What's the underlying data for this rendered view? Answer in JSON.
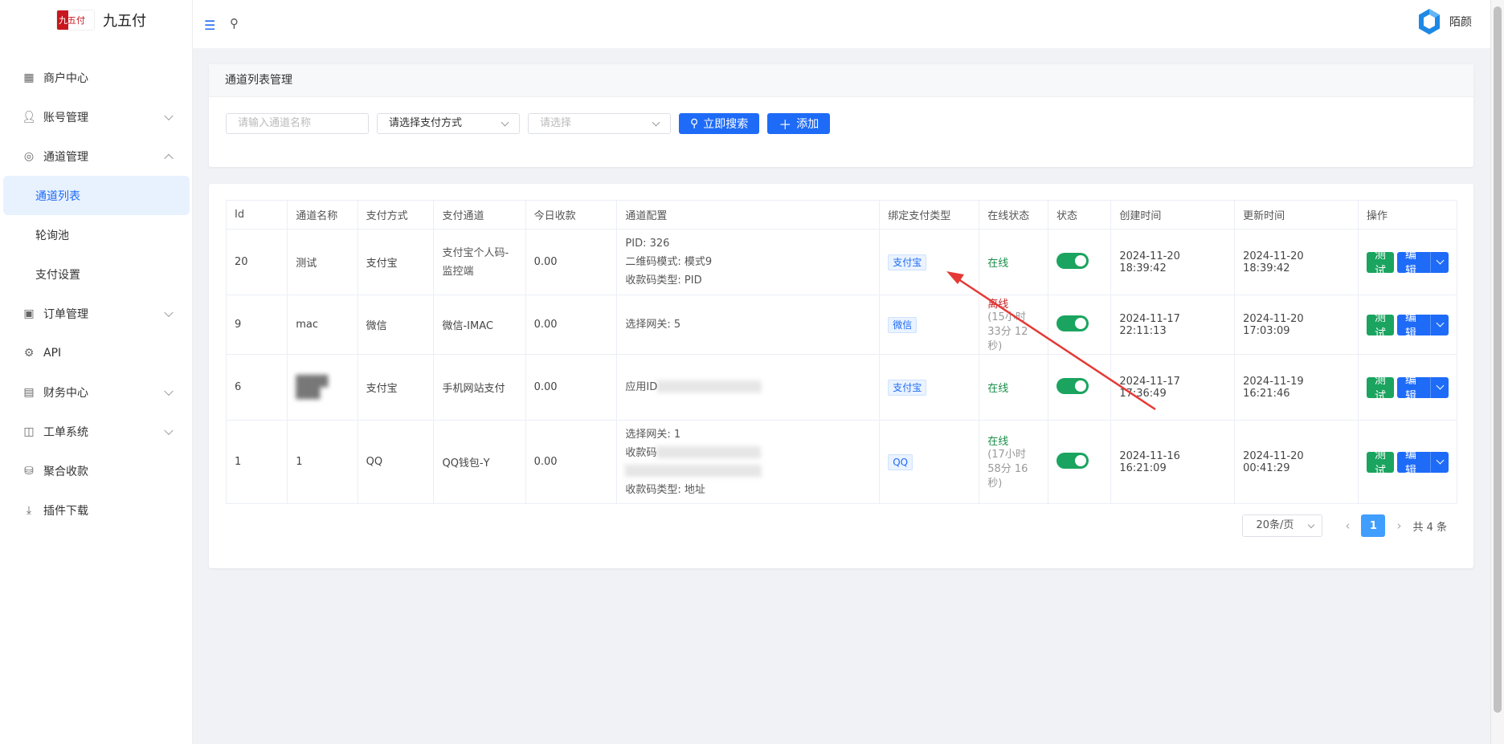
{
  "app": {
    "name": "九五付"
  },
  "user": {
    "name": "陌颜"
  },
  "sidebar": {
    "items": [
      {
        "label": "商户中心",
        "icon": "grid-icon"
      },
      {
        "label": "账号管理",
        "icon": "user-icon",
        "expandable": true
      },
      {
        "label": "通道管理",
        "icon": "channel-icon",
        "expandable": true,
        "expanded": true,
        "children": [
          {
            "label": "通道列表",
            "active": true
          },
          {
            "label": "轮询池"
          },
          {
            "label": "支付设置"
          }
        ]
      },
      {
        "label": "订单管理",
        "icon": "clipboard-icon",
        "expandable": true
      },
      {
        "label": "API",
        "icon": "api-icon"
      },
      {
        "label": "财务中心",
        "icon": "finance-icon",
        "expandable": true
      },
      {
        "label": "工单系统",
        "icon": "book-icon",
        "expandable": true
      },
      {
        "label": "聚合收款",
        "icon": "coins-icon"
      },
      {
        "label": "插件下载",
        "icon": "download-icon"
      }
    ]
  },
  "filter_card": {
    "title": "通道列表管理",
    "name_placeholder": "请输入通道名称",
    "pay_method_placeholder": "请选择支付方式",
    "select_placeholder": "请选择",
    "search_label": "立即搜索",
    "add_label": "添加"
  },
  "table": {
    "headers": [
      "Id",
      "通道名称",
      "支付方式",
      "支付通道",
      "今日收款",
      "通道配置",
      "绑定支付类型",
      "在线状态",
      "状态",
      "创建时间",
      "更新时间",
      "操作"
    ],
    "rows": [
      {
        "id": "20",
        "name": "测试",
        "pay_method": "支付宝",
        "channel": "支付宝个人码-监控端",
        "today": "0.00",
        "config": [
          "PID: 326",
          "二维码模式: 模式9",
          "收款码类型: PID"
        ],
        "bind_type": "支付宝",
        "online": "在线",
        "online_status": "online",
        "duration": "",
        "enabled": true,
        "created": "2024-11-20 18:39:42",
        "updated": "2024-11-20 18:39:42"
      },
      {
        "id": "9",
        "name": "mac",
        "pay_method": "微信",
        "channel": "微信-IMAC",
        "today": "0.00",
        "config": [
          "选择网关: 5"
        ],
        "bind_type": "微信",
        "online": "离线",
        "online_status": "offline",
        "duration": "(15小时 33分 12秒)",
        "enabled": true,
        "created": "2024-11-17 22:11:13",
        "updated": "2024-11-20 17:03:09"
      },
      {
        "id": "6",
        "name": "",
        "pay_method": "支付宝",
        "channel": "手机网站支付",
        "today": "0.00",
        "config": [
          "应用ID"
        ],
        "bind_type": "支付宝",
        "online": "在线",
        "online_status": "online",
        "duration": "",
        "enabled": true,
        "created": "2024-11-17 17:36:49",
        "updated": "2024-11-19 16:21:46"
      },
      {
        "id": "1",
        "name": "1",
        "pay_method": "QQ",
        "channel": "QQ钱包-Y",
        "today": "0.00",
        "config": [
          "选择网关: 1",
          "收款码",
          "",
          "收款码类型: 地址"
        ],
        "bind_type": "QQ",
        "online": "在线",
        "online_status": "online",
        "duration": "(17小时 58分 16秒)",
        "enabled": true,
        "created": "2024-11-16 16:21:09",
        "updated": "2024-11-20 00:41:29"
      }
    ],
    "op_test": "测试",
    "op_edit": "编辑"
  },
  "pagination": {
    "page_size": "20条/页",
    "current": "1",
    "total": "共 4 条"
  },
  "colors": {
    "primary": "#1e6bf7",
    "success": "#1aa45f",
    "danger": "#c62828",
    "annotation_arrow": "#e53935"
  }
}
